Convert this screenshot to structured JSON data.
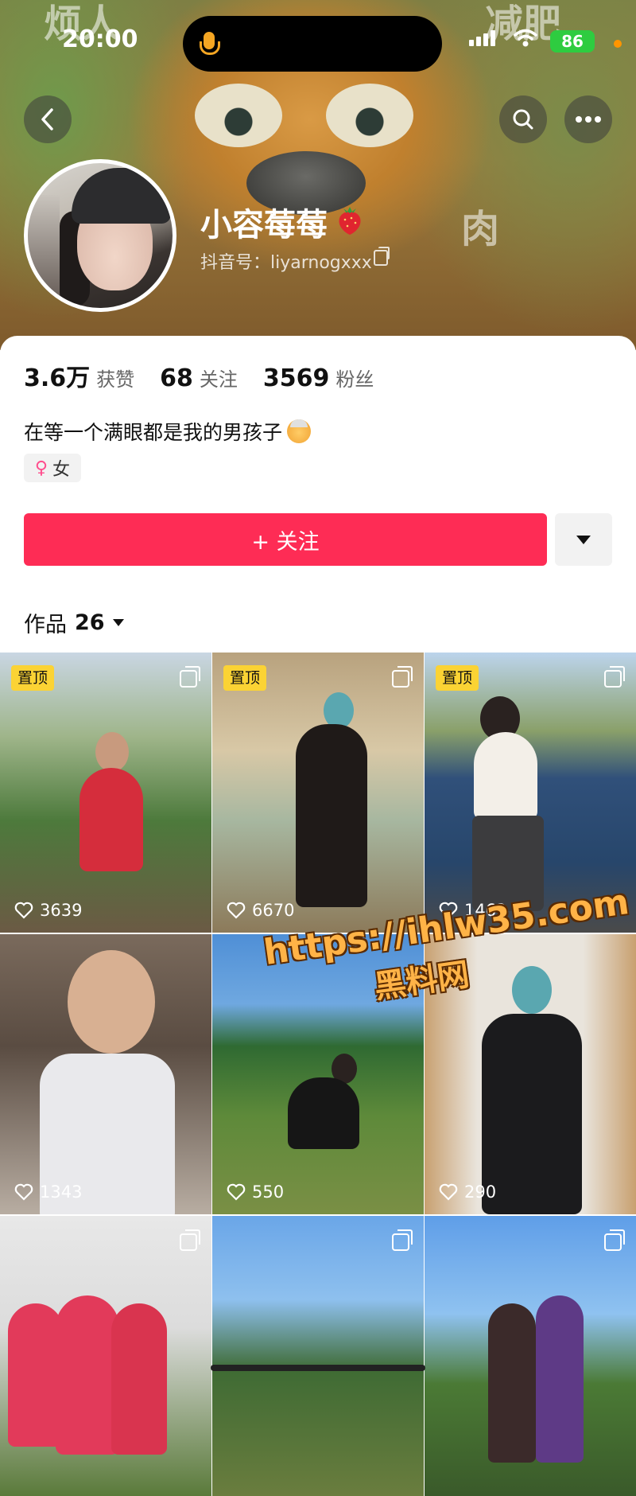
{
  "status_bar": {
    "time": "20:00",
    "battery": "86"
  },
  "cover": {
    "deco_left": "烦人",
    "deco_right": "减肥",
    "deco_mid": "肉"
  },
  "profile": {
    "nickname": "小容莓莓",
    "douyin_id": "抖音号：liyarnogxxx",
    "stats": [
      {
        "value": "3.6万",
        "label": "获赞"
      },
      {
        "value": "68",
        "label": "关注"
      },
      {
        "value": "3569",
        "label": "粉丝"
      }
    ],
    "bio": "在等一个满眼都是我的男孩子",
    "gender": "女"
  },
  "actions": {
    "follow_label": "+ 关注"
  },
  "works": {
    "label": "作品",
    "count": "26"
  },
  "videos": [
    {
      "pinned": true,
      "pin_label": "置顶",
      "likes": "3639"
    },
    {
      "pinned": true,
      "pin_label": "置顶",
      "likes": "6670"
    },
    {
      "pinned": true,
      "pin_label": "置顶",
      "likes": "1462"
    },
    {
      "pinned": false,
      "likes": "1343"
    },
    {
      "pinned": false,
      "likes": "550"
    },
    {
      "pinned": false,
      "likes": "290"
    },
    {
      "pinned": false,
      "likes": ""
    },
    {
      "pinned": false,
      "likes": ""
    },
    {
      "pinned": false,
      "likes": ""
    }
  ],
  "watermark": {
    "url": "https://ihlw35.com",
    "name": "黑料网"
  }
}
